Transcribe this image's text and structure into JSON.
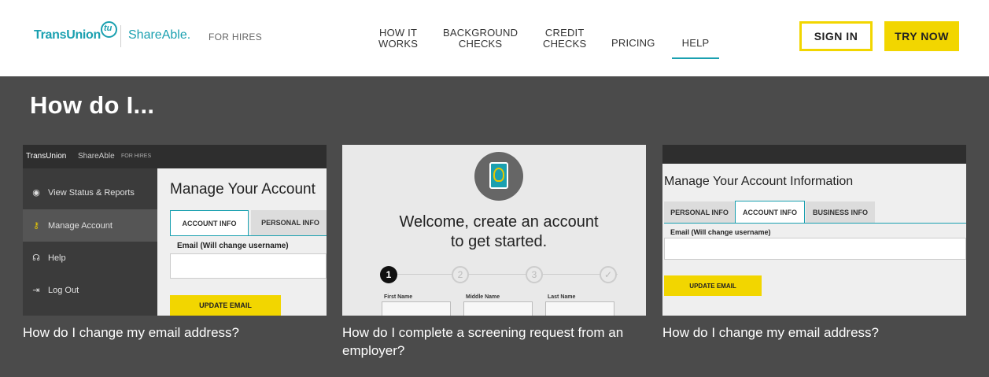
{
  "header": {
    "logo": {
      "brand": "TransUnion",
      "badge": "tu",
      "product": "ShareAble.",
      "suffix": "FOR HIRES"
    },
    "nav": [
      {
        "label": "HOW IT WORKS",
        "line1": "HOW IT",
        "line2": "WORKS"
      },
      {
        "label": "BACKGROUND CHECKS",
        "line1": "BACKGROUND",
        "line2": "CHECKS"
      },
      {
        "label": "CREDIT CHECKS",
        "line1": "CREDIT",
        "line2": "CHECKS"
      },
      {
        "label": "PRICING"
      },
      {
        "label": "HELP",
        "active": true
      }
    ],
    "sign_in": "SIGN IN",
    "try_now": "TRY NOW"
  },
  "main": {
    "title": "How do I...",
    "cards": [
      {
        "caption": "How do I change my email address?",
        "thumb": {
          "brand": "TransUnion",
          "product": "ShareAble",
          "suffix": "FOR HIRES",
          "menu": [
            "View Status & Reports",
            "Manage Account",
            "Help",
            "Log Out"
          ],
          "heading": "Manage Your Account",
          "tabs": [
            "ACCOUNT INFO",
            "PERSONAL INFO"
          ],
          "field_label": "Email (Will change username)",
          "button": "UPDATE EMAIL"
        }
      },
      {
        "caption": "How do I complete a screening request from an employer?",
        "thumb": {
          "welcome_line1": "Welcome, create an account",
          "welcome_line2": "to get started.",
          "steps": [
            "1",
            "2",
            "3",
            "✓"
          ],
          "fields": [
            "First Name",
            "Middle Name",
            "Last Name"
          ]
        }
      },
      {
        "caption": "How do I change my email address?",
        "thumb": {
          "heading": "Manage Your Account Information",
          "tabs": [
            "PERSONAL INFO",
            "ACCOUNT INFO",
            "BUSINESS INFO"
          ],
          "field_label": "Email (Will change username)",
          "button": "UPDATE EMAIL"
        }
      }
    ]
  },
  "colors": {
    "accent": "#1aa0b0",
    "cta": "#f2d600",
    "band": "#4b4b4b"
  }
}
